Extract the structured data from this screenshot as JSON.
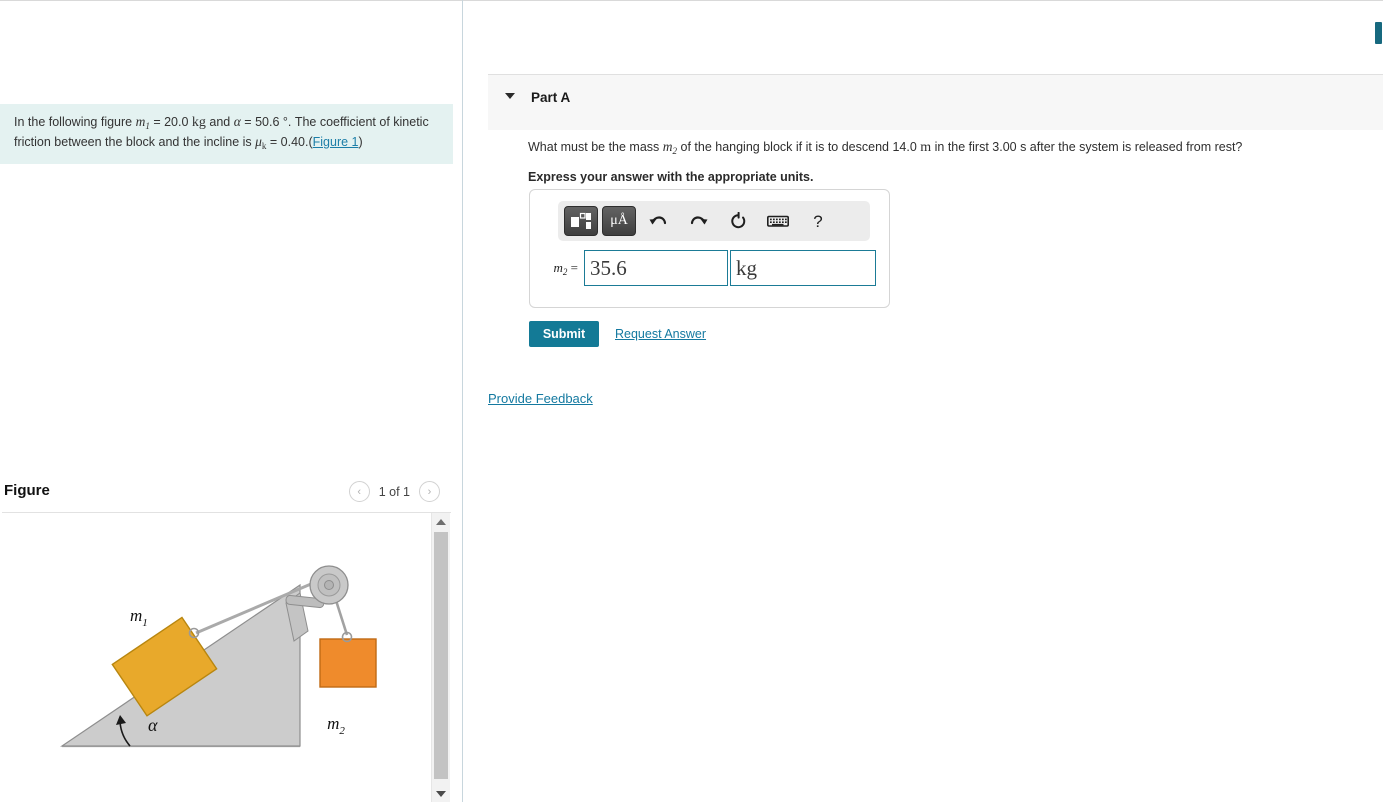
{
  "question": {
    "text_part1": "In the following figure ",
    "m1_symbol": "m",
    "m1_sub": "1",
    "text_part2": " = 20.0 ",
    "kg_unit": "kg",
    "text_part3": " and ",
    "alpha_symbol": "α",
    "text_part4": " = 50.6 ",
    "degree_symbol": "°",
    "text_part5": ". The coefficient of kinetic friction between the block and the incline is ",
    "mu_symbol": "μ",
    "mu_sub": "k",
    "text_part6": " = 0.40.",
    "figure_link": "Figure 1",
    "paren_open": "(",
    "paren_close": ")"
  },
  "figure_panel": {
    "title": "Figure",
    "counter": "1 of 1",
    "prev_icon": "chevron-left-icon",
    "next_icon": "chevron-right-icon",
    "prev_glyph": "‹",
    "next_glyph": "›",
    "diagram": {
      "block1_label": "m",
      "block1_sub": "1",
      "block2_label": "m",
      "block2_sub": "2",
      "angle_label": "α",
      "incline_color": "#cccccc",
      "incline_stroke": "#8c8c8c",
      "block1_color": "#e8a92b",
      "block1_stroke": "#b8860f",
      "block2_color": "#ef8b2c",
      "block2_stroke": "#c06a14",
      "rope_color": "#a8a8a8",
      "pulley_color": "#c6c6c6"
    },
    "scrollbar": {
      "up_icon": "scroll-up-arrow-icon",
      "down_icon": "scroll-down-arrow-icon"
    }
  },
  "part_a": {
    "caret_icon": "caret-down-icon",
    "title": "Part A",
    "prompt_part1": "What must be the mass ",
    "prompt_m2": "m",
    "prompt_m2_sub": "2",
    "prompt_part2": " of the hanging block if it is to descend 14.0 ",
    "prompt_m_unit": "m",
    "prompt_part3": " in the first 3.00 s after the system is released from rest?",
    "instruction": "Express your answer with the appropriate units."
  },
  "answer_widget": {
    "toolbar": {
      "template_icon": "math-template-icon",
      "units_label": "μÅ",
      "units_icon": "units-symbol-icon",
      "undo_icon": "undo-arrow-icon",
      "undo_glyph": "↶",
      "redo_icon": "redo-arrow-icon",
      "redo_glyph": "↷",
      "reset_icon": "reset-circular-arrow-icon",
      "reset_glyph": "↺",
      "keyboard_icon": "keyboard-icon",
      "help_icon": "help-question-mark-icon",
      "help_glyph": "?"
    },
    "label_symbol": "m",
    "label_sub": "2",
    "label_equals": " =",
    "value": "35.6",
    "units": "kg",
    "border_color": "#1b7b96"
  },
  "actions": {
    "submit_label": "Submit",
    "submit_color": "#137a96",
    "request_answer_label": "Request Answer",
    "provide_feedback_label": "Provide Feedback",
    "link_color": "#1479a0"
  },
  "page_scrollbar": {
    "thumb_color": "#17697f"
  }
}
